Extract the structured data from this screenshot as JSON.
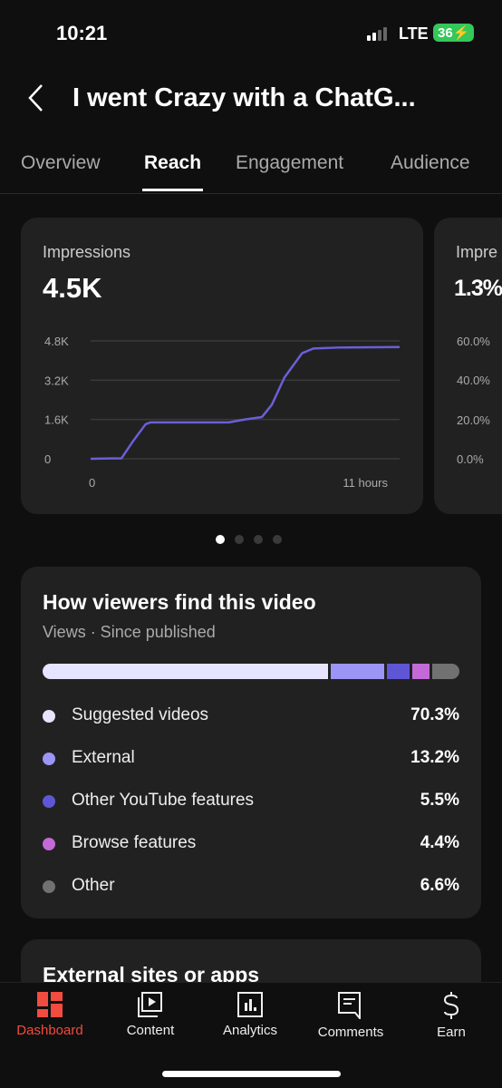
{
  "status_bar": {
    "time": "10:21",
    "network": "LTE",
    "battery": "36"
  },
  "header": {
    "title": "I went Crazy with a ChatG..."
  },
  "tabs": [
    {
      "label": "Overview"
    },
    {
      "label": "Reach",
      "active": true
    },
    {
      "label": "Engagement"
    },
    {
      "label": "Audience"
    }
  ],
  "impressions_card": {
    "label": "Impressions",
    "value": "4.5K"
  },
  "ctr_card": {
    "label": "Impre",
    "value": "1.3%",
    "y_ticks": [
      "60.0%",
      "40.0%",
      "20.0%",
      "0.0%"
    ]
  },
  "carousel": {
    "pages": 4,
    "active": 1
  },
  "chart_data": {
    "type": "line",
    "xlabel": "",
    "ylabel": "",
    "x_ticks": [
      "0",
      "11 hours"
    ],
    "y_ticks": [
      "0",
      "1.6K",
      "3.2K",
      "4.8K"
    ],
    "xlim": [
      0,
      11
    ],
    "ylim": [
      0,
      4800
    ],
    "grid": true,
    "color": "#6a5fd8",
    "x": [
      0,
      1.1,
      1.5,
      1.96,
      2.13,
      4.91,
      5.5,
      6.1,
      6.45,
      6.9,
      7.53,
      7.93,
      8.84,
      11
    ],
    "y": [
      0,
      20,
      700,
      1410,
      1480,
      1480,
      1600,
      1700,
      2200,
      3310,
      4300,
      4490,
      4530,
      4550
    ]
  },
  "traffic": {
    "title": "How viewers find this video",
    "subtitle": "Views · Since published",
    "sources": [
      {
        "label": "Suggested videos",
        "pct": "70.3%",
        "value": 70.3,
        "color": "#e6e4ff"
      },
      {
        "label": "External",
        "pct": "13.2%",
        "value": 13.2,
        "color": "#9b95f5"
      },
      {
        "label": "Other YouTube features",
        "pct": "5.5%",
        "value": 5.5,
        "color": "#5f56d6"
      },
      {
        "label": "Browse features",
        "pct": "4.4%",
        "value": 4.4,
        "color": "#c36ad6"
      },
      {
        "label": "Other",
        "pct": "6.6%",
        "value": 6.6,
        "color": "#717171"
      }
    ]
  },
  "next_card": {
    "title": "External sites or apps"
  },
  "nav": [
    {
      "label": "Dashboard",
      "active": true
    },
    {
      "label": "Content"
    },
    {
      "label": "Analytics"
    },
    {
      "label": "Comments"
    },
    {
      "label": "Earn"
    }
  ],
  "colors": {
    "accent": "#f24b3f",
    "card": "#212121",
    "bg": "#0f0f0f"
  }
}
